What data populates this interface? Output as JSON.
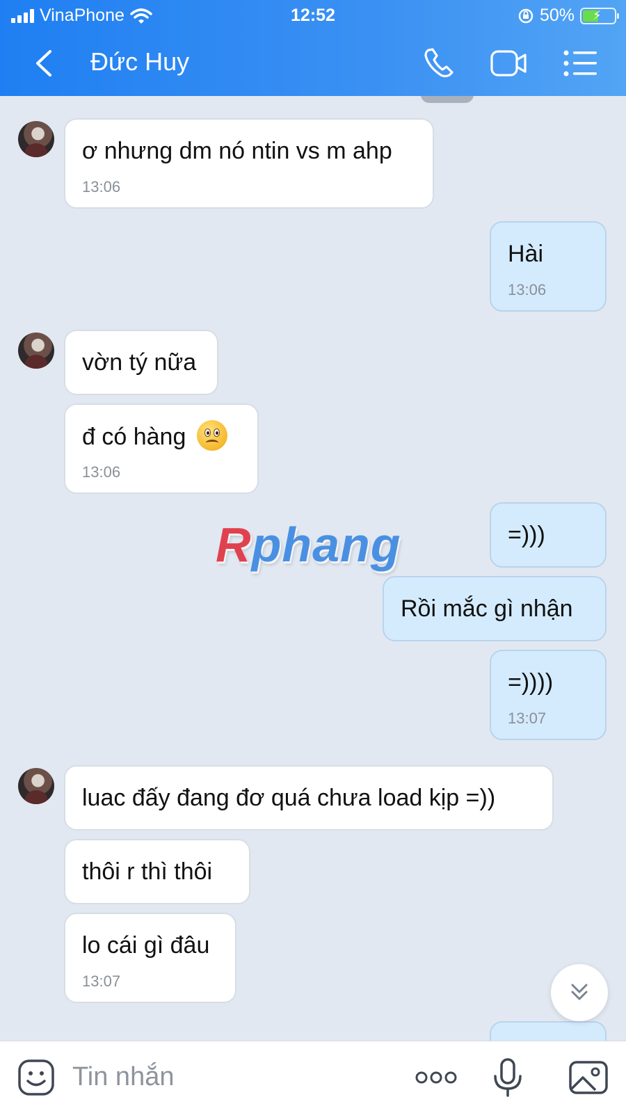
{
  "status_bar": {
    "carrier": "VinaPhone",
    "time": "12:52",
    "battery": "50%"
  },
  "header": {
    "contact_name": "Đức Huy"
  },
  "messages": [
    {
      "side": "in",
      "text": "ơ nhưng dm nó ntin vs m ahp",
      "time": "13:06"
    },
    {
      "side": "out",
      "text": "Hài",
      "time": "13:06"
    },
    {
      "side": "in",
      "text": "vờn tý nữa",
      "time": ""
    },
    {
      "side": "in",
      "text": "đ có hàng",
      "time": "13:06",
      "emoji": "sad-face"
    },
    {
      "side": "out",
      "text": "=)))",
      "time": ""
    },
    {
      "side": "out",
      "text": "Rồi mắc gì nhận",
      "time": ""
    },
    {
      "side": "out",
      "text": "=))))",
      "time": "13:07"
    },
    {
      "side": "in",
      "text": "luac đấy đang đơ quá chưa load kịp =))",
      "time": ""
    },
    {
      "side": "in",
      "text": "thôi r thì thôi",
      "time": ""
    },
    {
      "side": "in",
      "text": "lo cái gì đâu",
      "time": "13:07"
    }
  ],
  "watermark": {
    "part1": "R",
    "part2": "phang"
  },
  "composer": {
    "placeholder": "Tin nhắn"
  },
  "icons": {
    "back": "chevron-left-icon",
    "call": "phone-icon",
    "video": "video-camera-icon",
    "menu": "list-menu-icon",
    "scroll": "double-chevron-down-icon",
    "sticker": "sticker-icon",
    "more": "more-dots-icon",
    "mic": "microphone-icon",
    "image": "image-icon"
  },
  "colors": {
    "header_start": "#1f7ff2",
    "header_end": "#52a4f4",
    "chat_bg": "#e2e8f1",
    "outgoing_bubble": "#d4ebfd",
    "incoming_bubble": "#ffffff"
  }
}
